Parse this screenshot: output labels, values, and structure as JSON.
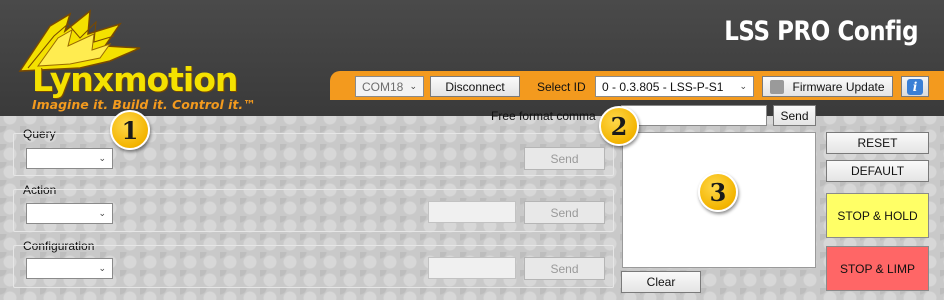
{
  "app": {
    "title": "LSS PRO Config",
    "logo_text": "Lynxmotion",
    "logo_tagline": "Imagine it.  Build it.  Control it.™"
  },
  "toolbar": {
    "com_port": "COM18",
    "connect_button": "Disconnect",
    "select_id_label": "Select ID",
    "select_id_value": "0 - 0.3.805 - LSS-P-S1",
    "firmware_button": "Firmware Update",
    "info_icon": "info-icon"
  },
  "free_format": {
    "label": "Free format comma",
    "input_value": "",
    "send_button": "Send"
  },
  "query": {
    "label": "Query",
    "select_value": "",
    "send_button": "Send"
  },
  "action": {
    "label": "Action",
    "select_value": "",
    "param_value": "",
    "send_button": "Send"
  },
  "configuration": {
    "label": "Configuration",
    "select_value": "",
    "param_value": "",
    "send_button": "Send"
  },
  "output": {
    "clear_button": "Clear"
  },
  "side_buttons": {
    "reset": "RESET",
    "default": "DEFAULT",
    "stop_hold": "STOP & HOLD",
    "stop_limp": "STOP & LIMP"
  },
  "badges": {
    "one": "1",
    "two": "2",
    "three": "3"
  },
  "colors": {
    "accent_orange": "#f39a1e",
    "header_dark": "#3f3f3f",
    "stop_hold": "#ffff66",
    "stop_limp": "#ff6666"
  }
}
